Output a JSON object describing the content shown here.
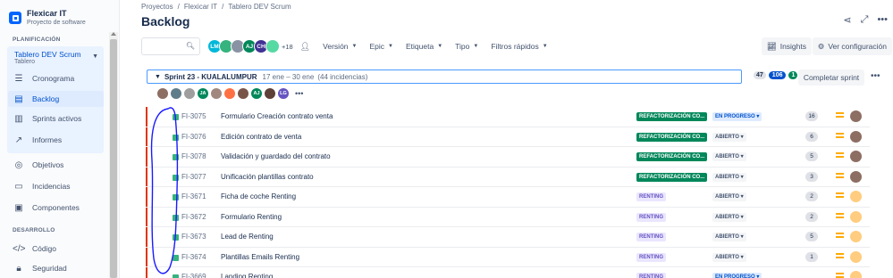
{
  "project": {
    "name": "Flexicar IT",
    "type": "Proyecto de software"
  },
  "sidebar": {
    "section_planning": "PLANIFICACIÓN",
    "board": {
      "title": "Tablero DEV Scrum",
      "subtitle": "Tablero"
    },
    "planning_items": [
      {
        "label": "Cronograma",
        "icon": "timeline-icon"
      },
      {
        "label": "Backlog",
        "icon": "backlog-icon",
        "active": true
      },
      {
        "label": "Sprints activos",
        "icon": "board-icon"
      },
      {
        "label": "Informes",
        "icon": "reports-icon"
      }
    ],
    "other_items": [
      {
        "label": "Objetivos",
        "icon": "goals-icon"
      },
      {
        "label": "Incidencias",
        "icon": "issues-icon"
      },
      {
        "label": "Componentes",
        "icon": "components-icon"
      }
    ],
    "section_dev": "DESARROLLO",
    "dev_items": [
      {
        "label": "Código",
        "icon": "code-icon"
      },
      {
        "label": "Seguridad",
        "icon": "lock-icon"
      }
    ]
  },
  "breadcrumb": {
    "p1": "Proyectos",
    "p2": "Flexicar IT",
    "p3": "Tablero DEV Scrum",
    "sep": "/"
  },
  "page_title": "Backlog",
  "toolbar": {
    "search_placeholder": "",
    "avatars": [
      {
        "initials": "LM",
        "color": "#00b8d9"
      },
      {
        "initials": "",
        "color": "#36b37e"
      },
      {
        "initials": "",
        "color": "#8993a4"
      },
      {
        "initials": "AJ",
        "color": "#00875a"
      },
      {
        "initials": "CH",
        "color": "#403294"
      },
      {
        "initials": "",
        "color": "#57d9a3"
      }
    ],
    "avatars_more": "+18",
    "filters": [
      "Versión",
      "Epic",
      "Etiqueta",
      "Tipo",
      "Filtros rápidos"
    ],
    "insights_label": "Insights",
    "config_label": "Ver configuración"
  },
  "sprint": {
    "name": "Sprint 23 - KUALALUMPUR",
    "dates": "17 ene – 30 ene",
    "count": "(44 incidencias)",
    "stat_todo": "47",
    "stat_progress": "106",
    "stat_done": "1",
    "complete_label": "Completar sprint",
    "assignees": [
      {
        "initials": "",
        "color": "#8d6e63"
      },
      {
        "initials": "",
        "color": "#607d8b"
      },
      {
        "initials": "",
        "color": "#9e9e9e"
      },
      {
        "initials": "JA",
        "color": "#00875a"
      },
      {
        "initials": "",
        "color": "#a1887f"
      },
      {
        "initials": "",
        "color": "#ff7043"
      },
      {
        "initials": "",
        "color": "#795548"
      },
      {
        "initials": "AJ",
        "color": "#00875a"
      },
      {
        "initials": "",
        "color": "#5d4037"
      },
      {
        "initials": "LG",
        "color": "#6554c0"
      }
    ]
  },
  "issues": [
    {
      "key": "FI-3075",
      "summary": "Formulario Creación contrato venta",
      "epic": "REFACTORIZACIÓN CO...",
      "epic_kind": "refac",
      "status": "EN PROGRESO",
      "status_kind": "prog",
      "points": "16",
      "av_color": "#8d6e63"
    },
    {
      "key": "FI-3076",
      "summary": "Edición contrato de venta",
      "epic": "REFACTORIZACIÓN CO...",
      "epic_kind": "refac",
      "status": "ABIERTO",
      "status_kind": "open",
      "points": "6",
      "av_color": "#8d6e63"
    },
    {
      "key": "FI-3078",
      "summary": "Validación y guardado del contrato",
      "epic": "REFACTORIZACIÓN CO...",
      "epic_kind": "refac",
      "status": "ABIERTO",
      "status_kind": "open",
      "points": "5",
      "av_color": "#8d6e63"
    },
    {
      "key": "FI-3077",
      "summary": "Unificación plantillas contrato",
      "epic": "REFACTORIZACIÓN CO...",
      "epic_kind": "refac",
      "status": "ABIERTO",
      "status_kind": "open",
      "points": "3",
      "av_color": "#8d6e63"
    },
    {
      "key": "FI-3671",
      "summary": "Ficha de coche Renting",
      "epic": "RENTING",
      "epic_kind": "renting",
      "status": "ABIERTO",
      "status_kind": "open",
      "points": "2",
      "av_color": "#ffcc80"
    },
    {
      "key": "FI-3672",
      "summary": "Formulario Renting",
      "epic": "RENTING",
      "epic_kind": "renting",
      "status": "ABIERTO",
      "status_kind": "open",
      "points": "2",
      "av_color": "#ffcc80"
    },
    {
      "key": "FI-3673",
      "summary": "Lead de Renting",
      "epic": "RENTING",
      "epic_kind": "renting",
      "status": "ABIERTO",
      "status_kind": "open",
      "points": "5",
      "av_color": "#ffcc80"
    },
    {
      "key": "FI-3674",
      "summary": "Plantillas Emails Renting",
      "epic": "RENTING",
      "epic_kind": "renting",
      "status": "ABIERTO",
      "status_kind": "open",
      "points": "1",
      "av_color": "#ffcc80"
    },
    {
      "key": "FI-3669",
      "summary": "Landing Renting",
      "epic": "RENTING",
      "epic_kind": "renting",
      "status": "EN PROGRESO",
      "status_kind": "prog",
      "points": "",
      "av_color": "#ffcc80"
    }
  ],
  "colors": {
    "accent": "#0052cc",
    "annotation": "#1a1aff"
  }
}
